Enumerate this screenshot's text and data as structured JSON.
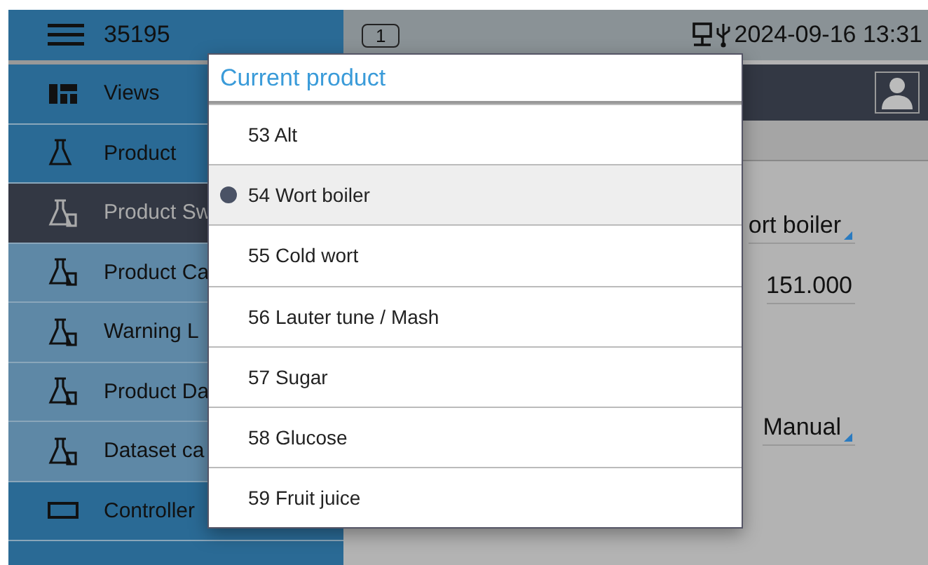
{
  "top_bar": {
    "device_id": "35195",
    "page_indicator": "1",
    "datetime": "2024-09-16 13:31"
  },
  "sidebar": {
    "items": [
      {
        "label": "Views",
        "selected": false,
        "kind": "main"
      },
      {
        "label": "Product",
        "selected": false,
        "kind": "main"
      },
      {
        "label": "Product Sw",
        "selected": true,
        "kind": "sub"
      },
      {
        "label": "Product Ca",
        "selected": false,
        "kind": "sub"
      },
      {
        "label": "Warning L",
        "selected": false,
        "kind": "sub"
      },
      {
        "label": "Product Da",
        "selected": false,
        "kind": "sub"
      },
      {
        "label": "Dataset ca",
        "selected": false,
        "kind": "sub"
      },
      {
        "label": "Controller",
        "selected": false,
        "kind": "main"
      }
    ]
  },
  "content": {
    "fields": [
      {
        "value": "ort boiler",
        "kind": "dropdown"
      },
      {
        "value": "151.000",
        "kind": "number"
      },
      {
        "value": "Manual",
        "kind": "dropdown"
      }
    ]
  },
  "popup": {
    "title": "Current product",
    "options": [
      {
        "label": "53 Alt",
        "selected": false
      },
      {
        "label": "54 Wort boiler",
        "selected": true
      },
      {
        "label": "55 Cold wort",
        "selected": false
      },
      {
        "label": "56 Lauter tune / Mash",
        "selected": false
      },
      {
        "label": "57 Sugar",
        "selected": false
      },
      {
        "label": "58 Glucose",
        "selected": false
      },
      {
        "label": "59 Fruit juice",
        "selected": false
      }
    ]
  }
}
